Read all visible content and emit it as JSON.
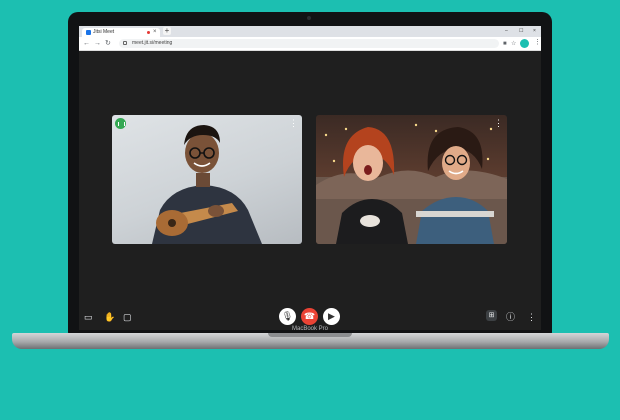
{
  "browser": {
    "tab_title": "Jitsi Meet",
    "new_tab_symbol": "+",
    "tab_close_symbol": "×",
    "url": "meet.jit.si/meeting",
    "window_controls": [
      "–",
      "☐",
      "×"
    ],
    "nav_icons": [
      "back-icon",
      "forward-icon",
      "reload-icon"
    ]
  },
  "meeting": {
    "participants": [
      {
        "tile": "participant-guitarist",
        "speaking": true
      },
      {
        "tile": "participant-two-women",
        "speaking": false
      }
    ],
    "controls_left": [
      "screen-share-icon",
      "raise-hand-icon",
      "chat-icon"
    ],
    "controls_center": [
      "microphone-icon",
      "hang-up-icon",
      "camera-icon"
    ],
    "controls_right": [
      "tile-view-icon",
      "info-icon",
      "more-options-icon"
    ]
  },
  "device": {
    "brand_label": "MacBook Pro"
  },
  "colors": {
    "background": "#1cbfb1",
    "hangup": "#ea4335",
    "speaking": "#34a853",
    "screen": "#1f1f1f"
  }
}
